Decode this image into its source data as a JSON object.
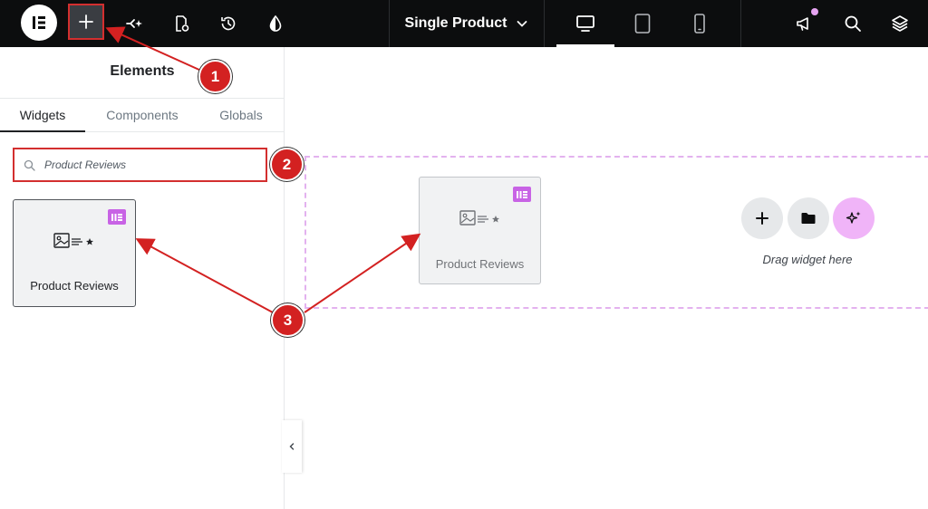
{
  "topbar": {
    "page_select_label": "Single Product",
    "icons": [
      "elementor-logo-icon",
      "plus-icon",
      "sparkle-icon",
      "page-settings-icon",
      "history-icon",
      "color-drop-icon",
      "chevron-down-icon",
      "desktop-icon",
      "tablet-icon",
      "mobile-icon",
      "megaphone-icon",
      "search-icon",
      "layers-icon"
    ]
  },
  "sidebar": {
    "title": "Elements",
    "tabs": [
      {
        "label": "Widgets"
      },
      {
        "label": "Components"
      },
      {
        "label": "Globals"
      }
    ],
    "search": {
      "value": "Product Reviews",
      "placeholder": ""
    },
    "widget": {
      "label": "Product Reviews"
    }
  },
  "canvas": {
    "dragged_widget_label": "Product Reviews",
    "drag_hint": "Drag widget here"
  },
  "annotations": {
    "steps": [
      "1",
      "2",
      "3"
    ]
  },
  "colors": {
    "topbar_bg": "#0c0d0e",
    "highlight_red": "#d32f2f",
    "pro_badge": "#c863e5",
    "ai_button": "#f0b4f8",
    "dashed_border": "#e3b2ef"
  }
}
